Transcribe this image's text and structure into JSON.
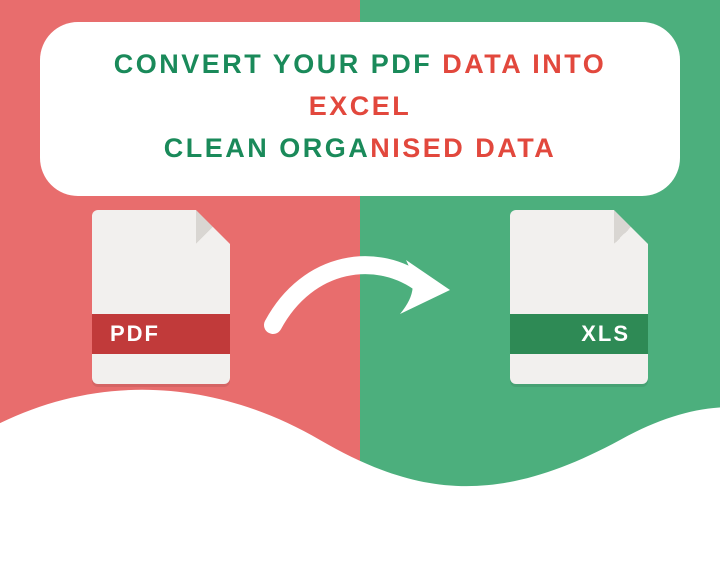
{
  "headline": "CONVERT YOUR PDF DATA INTO EXCEL\nCLEAN ORGANISED DATA",
  "colors": {
    "left_bg": "#e86d6d",
    "right_bg": "#4caf7d",
    "pdf_band": "#c13a3a",
    "xls_band": "#2e8a55",
    "text_green": "#1a8a5a",
    "text_red": "#e2483d"
  },
  "files": {
    "pdf_label": "PDF",
    "xls_label": "XLS"
  }
}
